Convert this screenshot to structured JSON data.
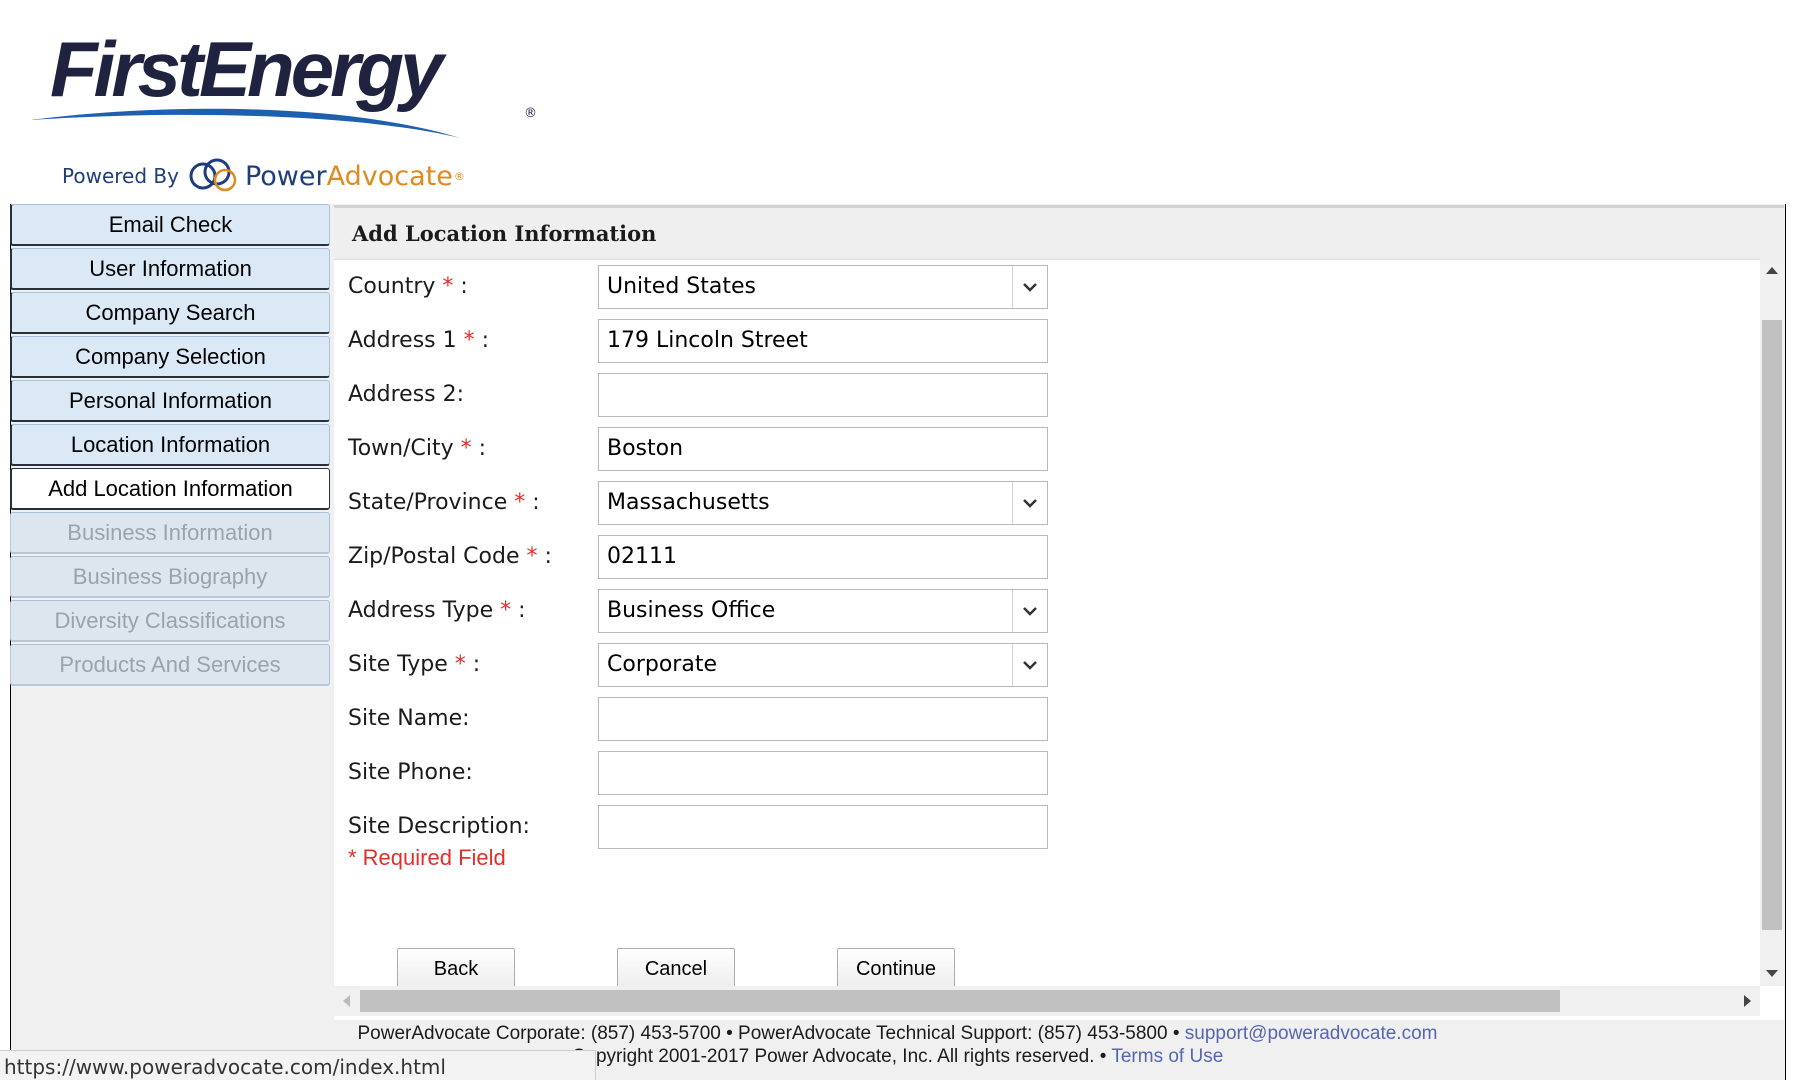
{
  "brand": {
    "logo_text": "FirstEnergy",
    "logo_reg": "®",
    "powered_by": "Powered By",
    "power_part1": "Power",
    "power_part2": "Advocate",
    "power_tm": "®",
    "colors": {
      "navy": "#1f3d7a",
      "orange": "#e08a1e",
      "swoosh": "#1f5fb0"
    }
  },
  "sidebar": {
    "items": [
      {
        "label": "Email Check",
        "state": "completed"
      },
      {
        "label": "User Information",
        "state": "completed"
      },
      {
        "label": "Company Search",
        "state": "completed"
      },
      {
        "label": "Company Selection",
        "state": "completed"
      },
      {
        "label": "Personal Information",
        "state": "completed"
      },
      {
        "label": "Location Information",
        "state": "completed"
      },
      {
        "label": "Add Location Information",
        "state": "active"
      },
      {
        "label": "Business Information",
        "state": "disabled"
      },
      {
        "label": "Business Biography",
        "state": "disabled"
      },
      {
        "label": "Diversity Classifications",
        "state": "disabled"
      },
      {
        "label": "Products And Services",
        "state": "disabled"
      }
    ]
  },
  "panel": {
    "title": "Add Location Information",
    "fields": [
      {
        "label": "Country",
        "required": true,
        "type": "select",
        "value": "United States"
      },
      {
        "label": "Address 1",
        "required": true,
        "type": "text",
        "value": "179 Lincoln Street"
      },
      {
        "label": "Address 2:",
        "required": false,
        "type": "text",
        "value": ""
      },
      {
        "label": "Town/City",
        "required": true,
        "type": "text",
        "value": "Boston"
      },
      {
        "label": "State/Province",
        "required": true,
        "type": "select",
        "value": "Massachusetts"
      },
      {
        "label": "Zip/Postal Code",
        "required": true,
        "type": "text",
        "value": "02111"
      },
      {
        "label": "Address Type",
        "required": true,
        "type": "select",
        "value": "Business Office"
      },
      {
        "label": "Site Type",
        "required": true,
        "type": "select",
        "value": "Corporate"
      },
      {
        "label": "Site Name:",
        "required": false,
        "type": "text",
        "value": ""
      },
      {
        "label": "Site Phone:",
        "required": false,
        "type": "text",
        "value": ""
      },
      {
        "label": "Site Description:",
        "required": false,
        "type": "text",
        "value": ""
      }
    ],
    "required_star": "*",
    "required_suffix": " :",
    "required_note": "* Required Field",
    "buttons": {
      "back": "Back",
      "cancel": "Cancel",
      "continue": "Continue"
    }
  },
  "footer": {
    "line1_text": "PowerAdvocate Corporate: (857) 453-5700 • PowerAdvocate Technical Support: (857) 453-5800 • ",
    "support_email": "support@poweradvocate.com",
    "line2_text": "Copyright 2001-2017 Power Advocate, Inc. All rights reserved. • ",
    "terms": "Terms of Use"
  },
  "statusbar": {
    "url": "https://www.poweradvocate.com/index.html"
  }
}
